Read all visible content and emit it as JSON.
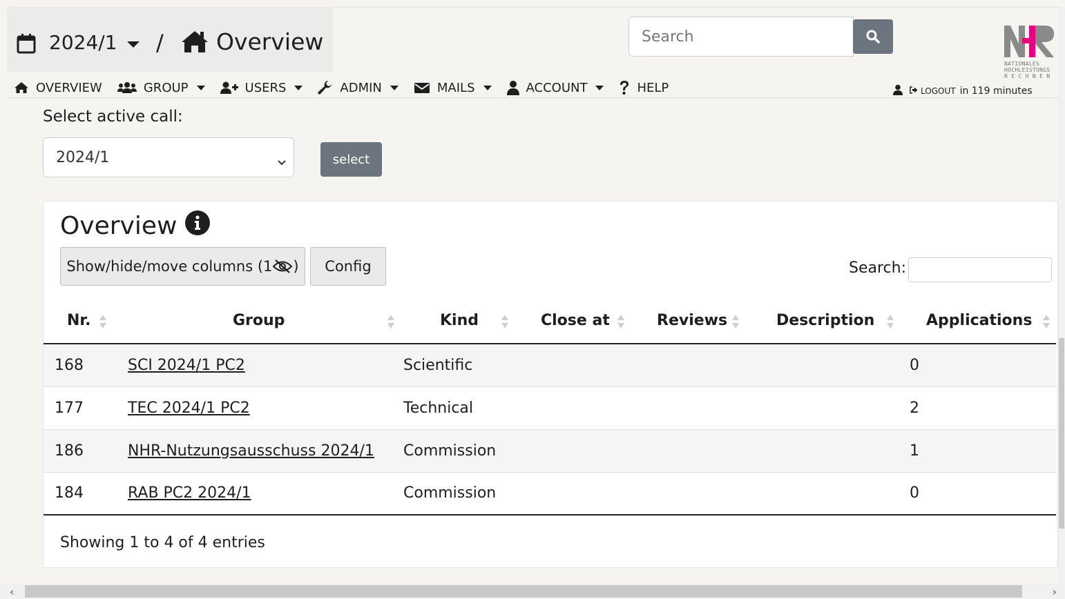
{
  "header": {
    "period": "2024/1",
    "separator": "/",
    "title": "Overview",
    "search_placeholder": "Search"
  },
  "logo": {
    "text": "NHR",
    "subtitle_lines": [
      "NATIONALES",
      "HOCHLEISTUNGS",
      "R E C H N E N"
    ],
    "colors": {
      "gray": "#8a8a8a",
      "pink": "#e6007e"
    }
  },
  "nav": {
    "items": [
      {
        "label": "OVERVIEW",
        "icon": "home-icon",
        "dropdown": false
      },
      {
        "label": "GROUP",
        "icon": "users-group-icon",
        "dropdown": true
      },
      {
        "label": "USERS",
        "icon": "user-plus-icon",
        "dropdown": true
      },
      {
        "label": "ADMIN",
        "icon": "wrench-icon",
        "dropdown": true
      },
      {
        "label": "MAILS",
        "icon": "envelope-icon",
        "dropdown": true
      },
      {
        "label": "ACCOUNT",
        "icon": "user-icon",
        "dropdown": true
      },
      {
        "label": "HELP",
        "icon": "question-icon",
        "dropdown": false
      }
    ]
  },
  "session": {
    "logout_label": "LOGOUT",
    "remaining": "in 119 minutes"
  },
  "call_select": {
    "label": "Select active call:",
    "value": "2024/1",
    "button_label": "select"
  },
  "card": {
    "title": "Overview",
    "columns_button": "Show/hide/move columns (1",
    "columns_button_end": ")",
    "config_button": "Config",
    "search_label": "Search:",
    "columns": [
      "Nr.",
      "Group",
      "Kind",
      "Close at",
      "Reviews",
      "Description",
      "Applications"
    ],
    "rows": [
      {
        "nr": "168",
        "group": "SCI 2024/1 PC2",
        "kind": "Scientific",
        "close_at": "",
        "reviews": "",
        "description": "",
        "applications": "0"
      },
      {
        "nr": "177",
        "group": "TEC 2024/1 PC2",
        "kind": "Technical",
        "close_at": "",
        "reviews": "",
        "description": "",
        "applications": "2"
      },
      {
        "nr": "186",
        "group": "NHR-Nutzungsausschuss 2024/1",
        "kind": "Commission",
        "close_at": "",
        "reviews": "",
        "description": "",
        "applications": "1"
      },
      {
        "nr": "184",
        "group": "RAB PC2 2024/1",
        "kind": "Commission",
        "close_at": "",
        "reviews": "",
        "description": "",
        "applications": "0"
      }
    ],
    "footer": "Showing 1 to 4 of 4 entries"
  },
  "colors": {
    "button_gray": "#6c757d",
    "page_bg": "#f5f4f1",
    "title_bg": "#ebebea"
  }
}
